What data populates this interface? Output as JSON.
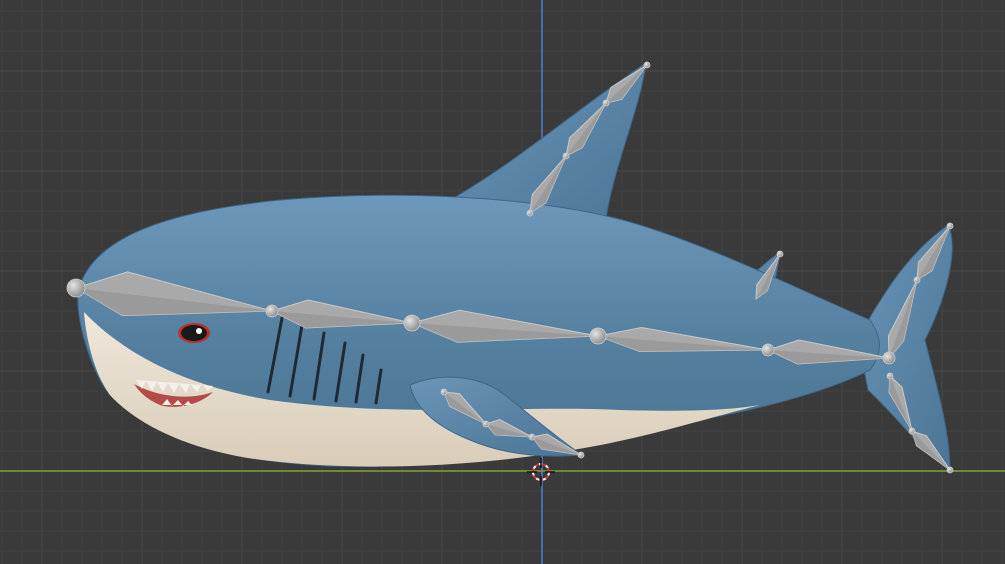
{
  "viewport": {
    "mode": "side-view",
    "background_color": "#3a3a3a",
    "grid": true,
    "x_axis_color": "#7fa33a",
    "z_axis_color": "#4f7fd1"
  },
  "scene": {
    "object": "shark-model",
    "armature": "shark-rig",
    "colors": {
      "skin_top": "#5a84a6",
      "skin_belly": "#e6dccb",
      "bone_fill": "#a9a9a9",
      "bone_edge": "#c9c9c9",
      "joint": "#bcbcbc",
      "eye_outline": "#b8312a",
      "teeth": "#f4efe8",
      "mouth": "#b44a4a",
      "cursor": "#d8333a"
    },
    "icons": [
      "3d-cursor-icon"
    ]
  }
}
